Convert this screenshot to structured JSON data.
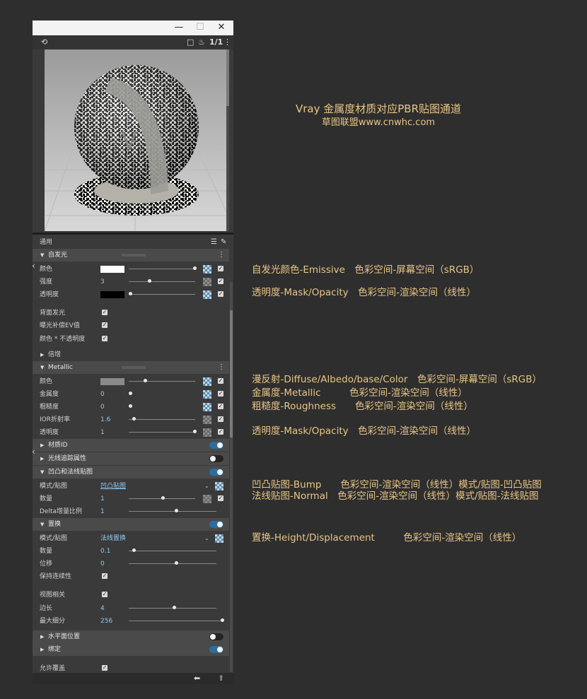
{
  "window": {
    "minimize": "—",
    "maximize": "☐",
    "close": "✕"
  },
  "toolbar": {
    "counter": "1/1"
  },
  "panel": {
    "header": "通用",
    "emissive": {
      "title": "自发光",
      "rows": [
        {
          "label": "颜色",
          "value": ""
        },
        {
          "label": "强度",
          "value": "3"
        },
        {
          "label": "透明度",
          "value": ""
        }
      ],
      "checks": [
        "背面发光",
        "曝光补偿EV值",
        "颜色 * 不透明度"
      ]
    },
    "multiply": "倍增",
    "metallic": {
      "title": "Metallic",
      "rows": [
        {
          "label": "颜色",
          "value": ""
        },
        {
          "label": "金属度",
          "value": "0"
        },
        {
          "label": "粗糙度",
          "value": "0"
        },
        {
          "label": "IOR折射率",
          "value": "1.6"
        },
        {
          "label": "透明度",
          "value": "1"
        }
      ]
    },
    "material_id": "材质ID",
    "raytrace": "光线追踪属性",
    "bump": {
      "title": "凹凸和法线贴图",
      "rows": [
        {
          "label": "模式/贴图",
          "value": "凹凸贴图"
        },
        {
          "label": "数量",
          "value": "1"
        },
        {
          "label": "Delta增量比例",
          "value": "1"
        }
      ]
    },
    "displacement": {
      "title": "置换",
      "rows": [
        {
          "label": "模式/贴图",
          "value": "法线置换"
        },
        {
          "label": "数量",
          "value": "0.1"
        },
        {
          "label": "位移",
          "value": "0"
        },
        {
          "label": "保持连续性",
          "value": ""
        },
        {
          "label": "视图相关",
          "value": ""
        },
        {
          "label": "边长",
          "value": "4"
        },
        {
          "label": "最大细分",
          "value": "256"
        }
      ]
    },
    "water_level": "水平面位置",
    "binding": "绑定",
    "allow_override": "允许覆盖"
  },
  "annotations": {
    "title": "Vray 金属度材质对应PBR贴图通道",
    "subtitle": "草图联盟www.cnwhc.com",
    "items": [
      "自发光颜色-Emissive　色彩空间-屏幕空间（sRGB）",
      "透明度-Mask/Opacity　色彩空间-渲染空间（线性）",
      "漫反射-Diffuse/Albedo/base/Color　色彩空间-屏幕空间（sRGB）",
      "金属度-Metallic　　　色彩空间-渲染空间（线性）",
      "粗糙度-Roughness　　色彩空间-渲染空间（线性）",
      "透明度-Mask/Opacity　色彩空间-渲染空间（线性）",
      "凹凸贴图-Bump　　色彩空间-渲染空间（线性）模式/贴图-凹凸贴图",
      "法线贴图-Normal　色彩空间-渲染空间（线性）模式/贴图-法线贴图",
      "置换-Height/Displacement　　　色彩空间-渲染空间（线性）"
    ]
  },
  "colors": {
    "accent": "#2c6d9d",
    "annotation": "#e9c585",
    "value_text": "#8ec9f0"
  }
}
